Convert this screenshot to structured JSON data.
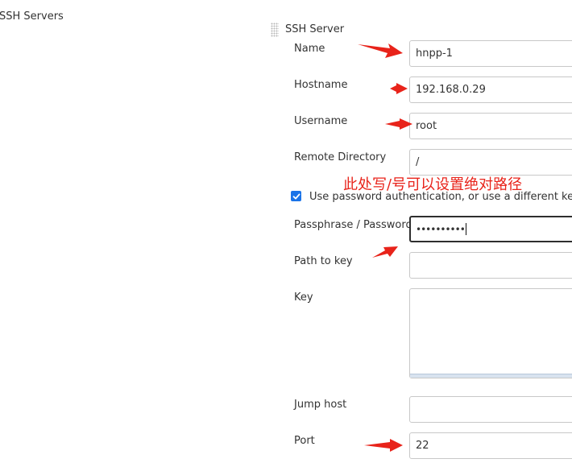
{
  "section": {
    "title": "SSH Servers"
  },
  "server": {
    "title": "SSH Server"
  },
  "fields": {
    "name": {
      "label": "Name",
      "value": "hnpp-1"
    },
    "hostname": {
      "label": "Hostname",
      "value": "192.168.0.29"
    },
    "username": {
      "label": "Username",
      "value": "root"
    },
    "remote_directory": {
      "label": "Remote Directory",
      "value": "/"
    },
    "use_password": {
      "label": "Use password authentication, or use a different key",
      "checked": true
    },
    "passphrase": {
      "label": "Passphrase / Password",
      "value": "••••••••••"
    },
    "path_to_key": {
      "label": "Path to key",
      "value": ""
    },
    "key": {
      "label": "Key",
      "value": ""
    },
    "jump_host": {
      "label": "Jump host",
      "value": ""
    },
    "port": {
      "label": "Port",
      "value": "22"
    }
  },
  "annotation": {
    "text": "此处写/号可以设置绝对路径",
    "color": "#e8231a"
  },
  "colors": {
    "checkbox_accent": "#1a73e8",
    "input_border": "#c8c8c8",
    "focused_border": "#2e2e2e"
  }
}
